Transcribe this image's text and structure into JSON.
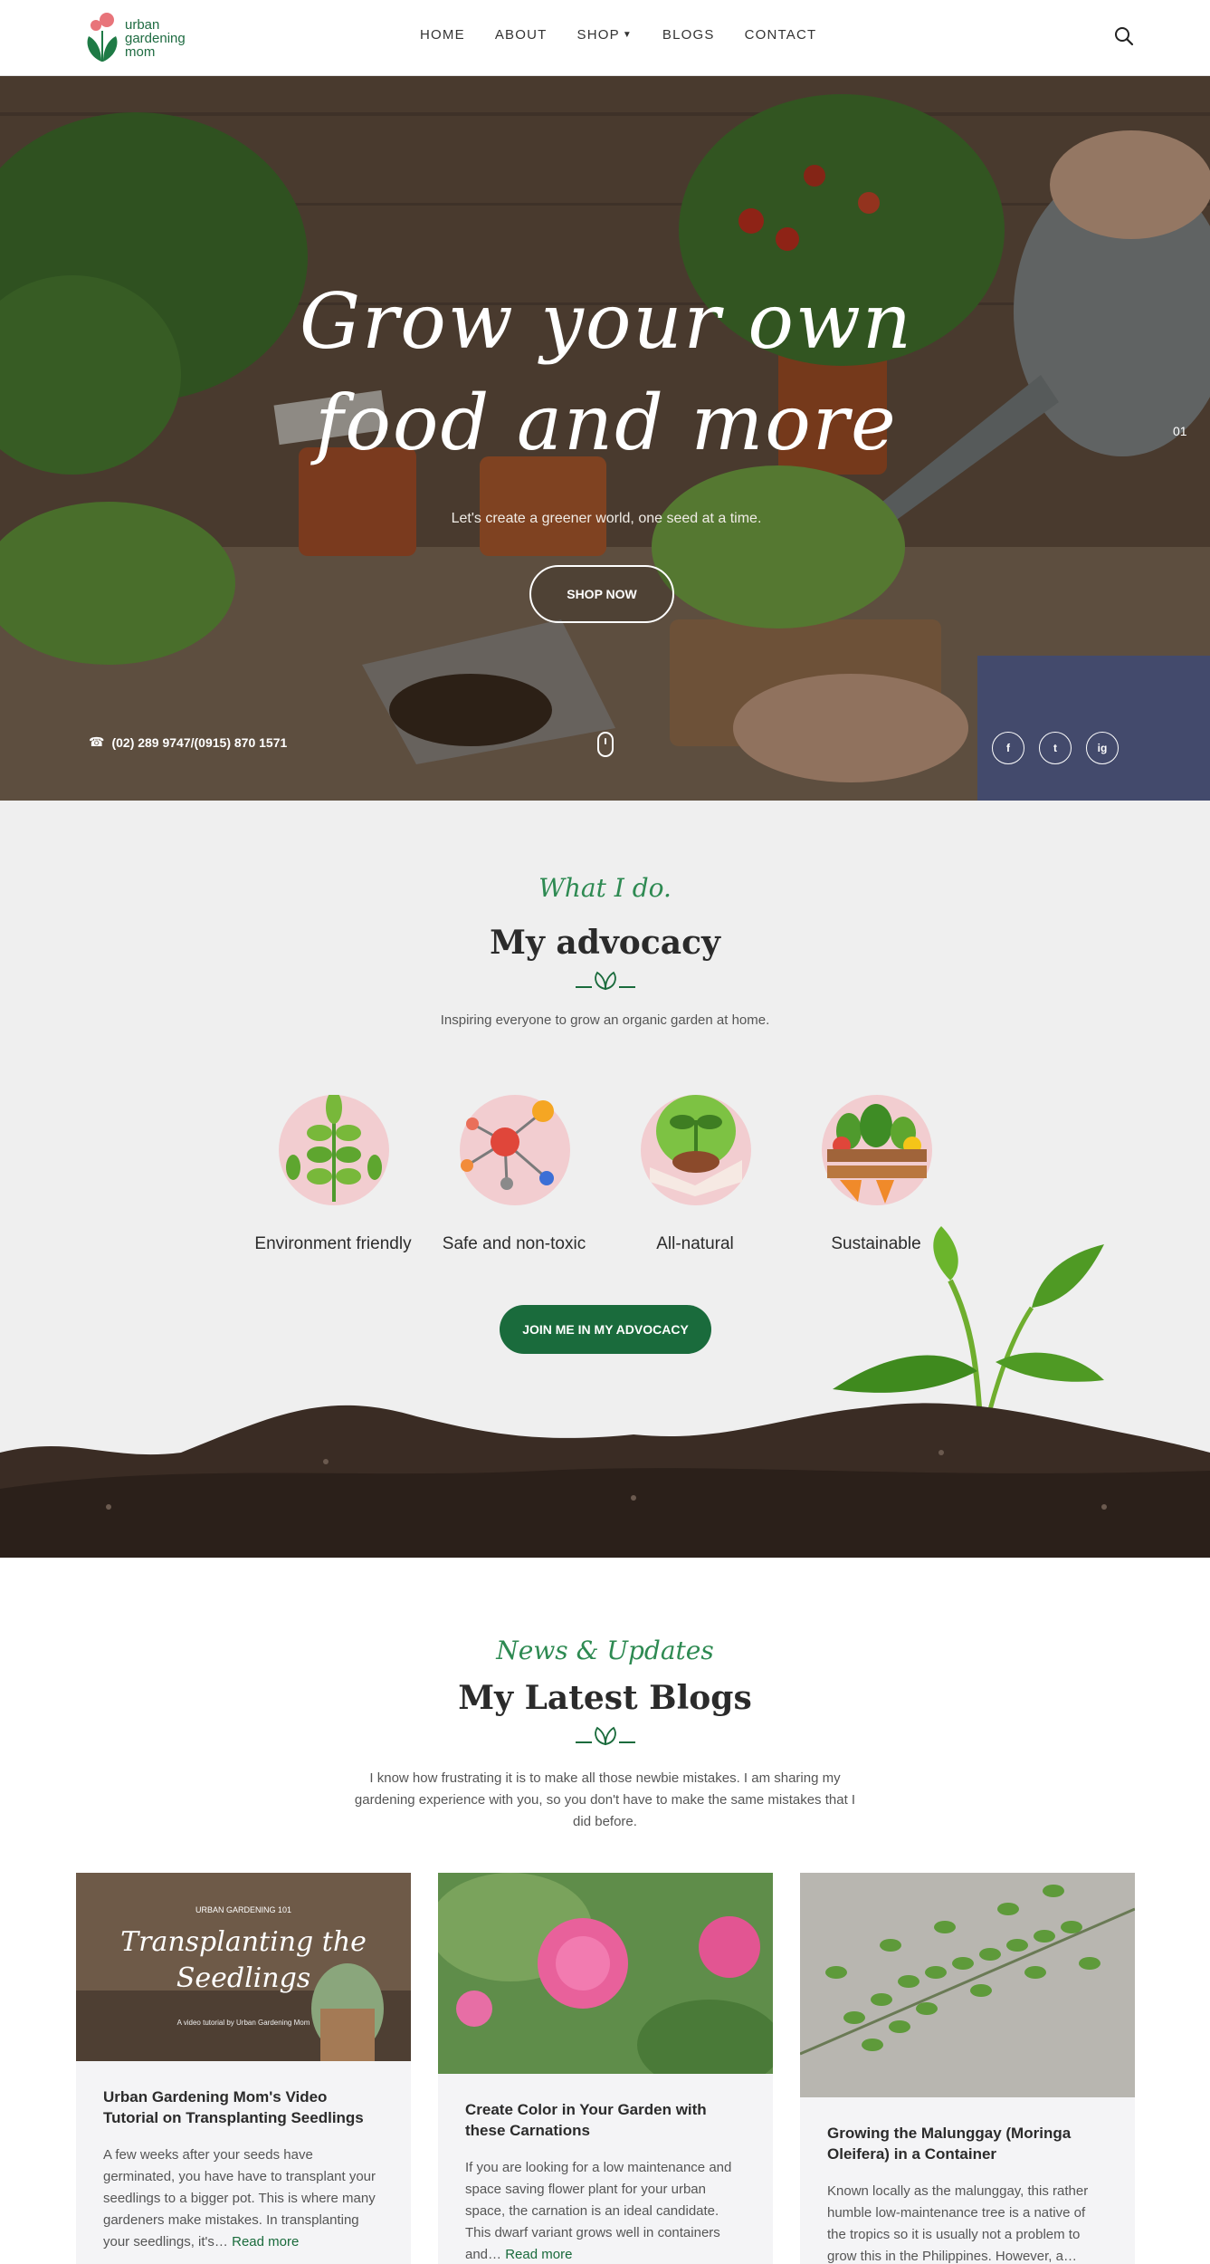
{
  "nav": {
    "logo_lines": [
      "urban",
      "gardening",
      "mom"
    ],
    "items": [
      {
        "label": "HOME"
      },
      {
        "label": "ABOUT"
      },
      {
        "label": "SHOP"
      },
      {
        "label": "BLOGS"
      },
      {
        "label": "CONTACT"
      }
    ]
  },
  "hero": {
    "title_line1": "Grow your own",
    "title_line2": "food and more",
    "subtitle": "Let's create a greener world, one seed at a time.",
    "button_label": "SHOP NOW",
    "slide_number": "01",
    "phone": "(02) 289 9747/(0915) 870 1571",
    "socials": [
      "f",
      "t",
      "ig"
    ]
  },
  "advocacy": {
    "script_heading": "What I do.",
    "title": "My advocacy",
    "lead": "Inspiring everyone to grow an organic garden at home.",
    "items": [
      {
        "label": "Environment friendly",
        "icon": "plant-icon"
      },
      {
        "label": "Safe and non-toxic",
        "icon": "molecule-icon"
      },
      {
        "label": "All-natural",
        "icon": "seedling-hand-icon"
      },
      {
        "label": "Sustainable",
        "icon": "vegetable-crate-icon"
      }
    ],
    "button_label": "JOIN ME IN MY ADVOCACY"
  },
  "blogs": {
    "script_heading": "News & Updates",
    "title": "My Latest Blogs",
    "lead": "I know how frustrating it is to make all those newbie mistakes. I am sharing my gardening experience with you, so you don't have to make the same mistakes that I did before.",
    "read_more": "Read more",
    "cards": [
      {
        "image_overline": "URBAN GARDENING 101",
        "image_title_line1": "Transplanting the",
        "image_title_line2": "Seedlings",
        "image_caption": "A video tutorial by Urban Gardening Mom",
        "title": "Urban Gardening Mom's Video Tutorial on Transplanting Seedlings",
        "excerpt": "A few weeks after your seeds have germinated, you have have to transplant your seedlings to a bigger pot. This is where many gardeners make mistakes. In transplanting your seedlings, it's…"
      },
      {
        "title": "Create Color in Your Garden with these Carnations",
        "excerpt": "If you are looking for a low maintenance and space saving flower plant for your urban space, the carnation is an ideal candidate. This dwarf variant grows well in containers and…"
      },
      {
        "title": "Growing the Malunggay (Moringa Oleifera) in a Container",
        "excerpt": "Known locally as the malunggay,  this rather humble low-maintenance tree is a native of the tropics so it is usually not a problem to grow this in the Philippines. However, a…"
      }
    ]
  },
  "colors": {
    "brand_green": "#1a6b3c",
    "script_green": "#2e8a52",
    "soft_pink": "#f2cdd0",
    "section_gray": "#efefef"
  }
}
